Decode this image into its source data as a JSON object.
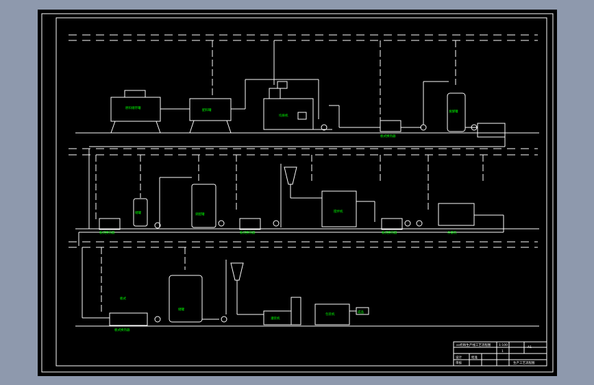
{
  "colors": {
    "background": "#8e99ad",
    "drawing": "#000000",
    "line": "#ffffff",
    "label": "#00ff00"
  },
  "drawing": {
    "row1_labels": {
      "l1": "原料储存罐",
      "l2": "配料罐",
      "l3": "均质机",
      "l4": "板式换热器",
      "l5": "发酵罐"
    },
    "row2_labels": {
      "l1": "板式换热器",
      "l2": "储罐",
      "l3": "调配罐",
      "l4": "板式换热器",
      "l5": "搅拌机",
      "l6": "板式换热器",
      "l7": "杀菌机"
    },
    "row3_labels": {
      "l1": "板式",
      "l2": "板式换热器",
      "l3": "储罐",
      "l4": "灌装机",
      "l5": "包装机",
      "l6": "成品"
    }
  },
  "title_block": {
    "title": "xx奶粉生产线工艺流程图",
    "scale": "1:100",
    "sheet": "1",
    "code": "A1",
    "design": "设计",
    "check": "审核",
    "approve": "批准",
    "footer": "生产工艺流程图"
  }
}
